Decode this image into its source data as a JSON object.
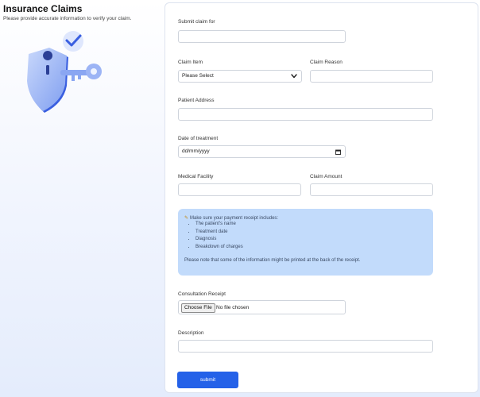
{
  "header": {
    "title": "Insurance Claims",
    "subtitle": "Please provide accurate information to verify your claim."
  },
  "form": {
    "submit_for": {
      "label": "Submit claim for",
      "value": ""
    },
    "claim_item": {
      "label": "Claim Item",
      "value": "Please Select"
    },
    "claim_reason": {
      "label": "Claim Reason",
      "value": ""
    },
    "patient_address": {
      "label": "Patient Address",
      "value": ""
    },
    "date_of_treatment": {
      "label": "Date of treatment",
      "value": "dd/mm/yyyy"
    },
    "medical_facility": {
      "label": "Medical Facility",
      "value": ""
    },
    "claim_amount": {
      "label": "Claim Amount",
      "value": ""
    },
    "info_box": {
      "heading": "Make sure your payment receipt includes:",
      "items": [
        "The patient's name",
        "Treatment date",
        "Diagnosis",
        "Breakdown of charges"
      ],
      "note": "Please note that some of the information might be printed at the back of the receipt."
    },
    "consultation_receipt": {
      "label": "Consultation Receipt",
      "button": "Choose File",
      "status": "No file chosen"
    },
    "description": {
      "label": "Description",
      "value": ""
    },
    "submit_label": "submit"
  },
  "colors": {
    "accent": "#2461e8",
    "info_bg": "#c2dbfb"
  },
  "icons": [
    "shield-icon",
    "key-icon",
    "checkmark-bubble-icon",
    "chevron-down-icon",
    "calendar-icon",
    "pencil-icon"
  ]
}
